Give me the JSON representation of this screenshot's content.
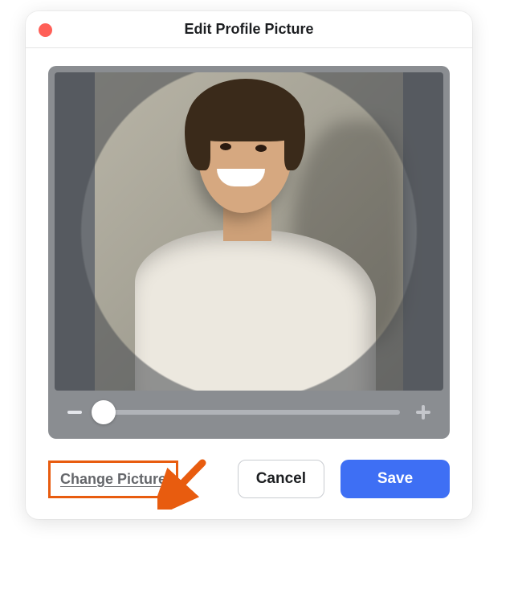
{
  "modal": {
    "title": "Edit Profile Picture",
    "change_label": "Change Picture",
    "cancel_label": "Cancel",
    "save_label": "Save"
  },
  "zoom": {
    "value": 0,
    "min": 0,
    "max": 100
  },
  "colors": {
    "accent": "#3e6ff4",
    "annotation": "#e85c0f",
    "close_dot": "#ff5f57",
    "panel_bg": "#8a8d91"
  },
  "icons": {
    "zoom_out": "minus-icon",
    "zoom_in": "plus-icon",
    "close": "close-dot-icon"
  },
  "annotation": {
    "arrow_points_to": "change-picture-link"
  }
}
